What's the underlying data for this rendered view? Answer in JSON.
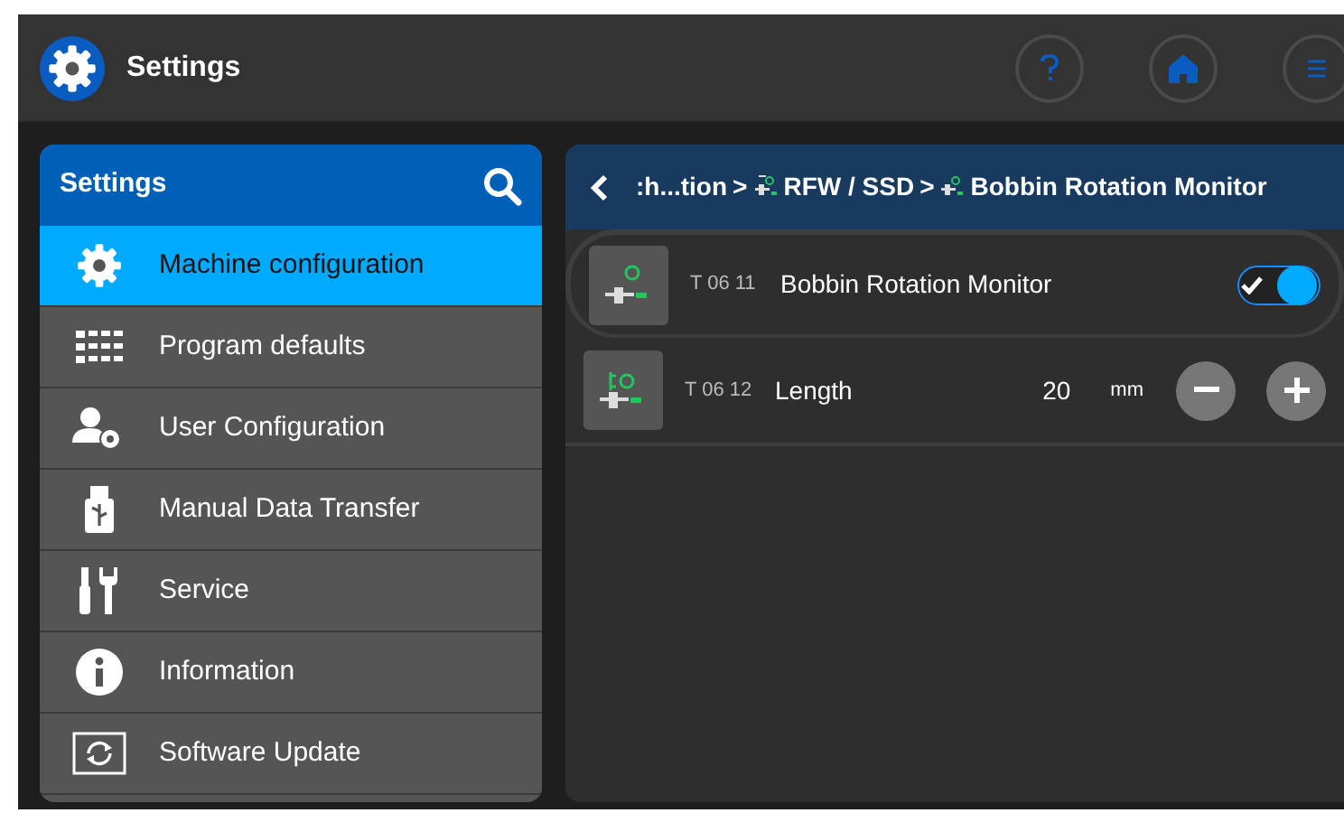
{
  "header": {
    "title": "Settings"
  },
  "sidebar": {
    "title": "Settings",
    "items": [
      {
        "label": "Machine configuration",
        "selected": true
      },
      {
        "label": "Program defaults",
        "selected": false
      },
      {
        "label": "User Configuration",
        "selected": false
      },
      {
        "label": "Manual Data Transfer",
        "selected": false
      },
      {
        "label": "Service",
        "selected": false
      },
      {
        "label": "Information",
        "selected": false
      },
      {
        "label": "Software Update",
        "selected": false
      }
    ]
  },
  "breadcrumb": [
    {
      "label": ":h...tion",
      "kind": "plain"
    },
    {
      "separator": ">",
      "label": "RFW / SSD",
      "kind": "machine"
    },
    {
      "separator": ">",
      "label": "Bobbin Rotation Monitor",
      "kind": "machine"
    }
  ],
  "parameters": [
    {
      "kind": "toggle",
      "code": "T 06 11",
      "name": "Bobbin Rotation Monitor",
      "on": true,
      "selected": true
    },
    {
      "kind": "number",
      "code": "T 06 12",
      "name": "Length",
      "value": "20",
      "unit": "mm",
      "selected": false
    }
  ]
}
